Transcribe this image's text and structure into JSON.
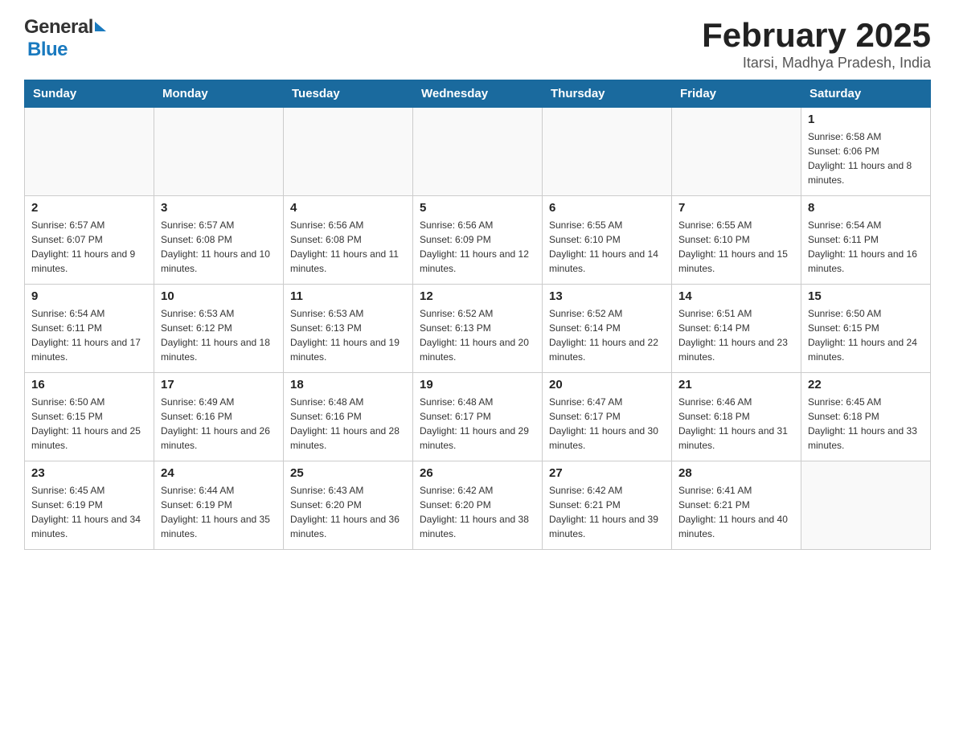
{
  "header": {
    "logo_general": "General",
    "logo_blue": "Blue",
    "title": "February 2025",
    "subtitle": "Itarsi, Madhya Pradesh, India"
  },
  "calendar": {
    "days_of_week": [
      "Sunday",
      "Monday",
      "Tuesday",
      "Wednesday",
      "Thursday",
      "Friday",
      "Saturday"
    ],
    "weeks": [
      [
        {
          "day": "",
          "info": ""
        },
        {
          "day": "",
          "info": ""
        },
        {
          "day": "",
          "info": ""
        },
        {
          "day": "",
          "info": ""
        },
        {
          "day": "",
          "info": ""
        },
        {
          "day": "",
          "info": ""
        },
        {
          "day": "1",
          "info": "Sunrise: 6:58 AM\nSunset: 6:06 PM\nDaylight: 11 hours and 8 minutes."
        }
      ],
      [
        {
          "day": "2",
          "info": "Sunrise: 6:57 AM\nSunset: 6:07 PM\nDaylight: 11 hours and 9 minutes."
        },
        {
          "day": "3",
          "info": "Sunrise: 6:57 AM\nSunset: 6:08 PM\nDaylight: 11 hours and 10 minutes."
        },
        {
          "day": "4",
          "info": "Sunrise: 6:56 AM\nSunset: 6:08 PM\nDaylight: 11 hours and 11 minutes."
        },
        {
          "day": "5",
          "info": "Sunrise: 6:56 AM\nSunset: 6:09 PM\nDaylight: 11 hours and 12 minutes."
        },
        {
          "day": "6",
          "info": "Sunrise: 6:55 AM\nSunset: 6:10 PM\nDaylight: 11 hours and 14 minutes."
        },
        {
          "day": "7",
          "info": "Sunrise: 6:55 AM\nSunset: 6:10 PM\nDaylight: 11 hours and 15 minutes."
        },
        {
          "day": "8",
          "info": "Sunrise: 6:54 AM\nSunset: 6:11 PM\nDaylight: 11 hours and 16 minutes."
        }
      ],
      [
        {
          "day": "9",
          "info": "Sunrise: 6:54 AM\nSunset: 6:11 PM\nDaylight: 11 hours and 17 minutes."
        },
        {
          "day": "10",
          "info": "Sunrise: 6:53 AM\nSunset: 6:12 PM\nDaylight: 11 hours and 18 minutes."
        },
        {
          "day": "11",
          "info": "Sunrise: 6:53 AM\nSunset: 6:13 PM\nDaylight: 11 hours and 19 minutes."
        },
        {
          "day": "12",
          "info": "Sunrise: 6:52 AM\nSunset: 6:13 PM\nDaylight: 11 hours and 20 minutes."
        },
        {
          "day": "13",
          "info": "Sunrise: 6:52 AM\nSunset: 6:14 PM\nDaylight: 11 hours and 22 minutes."
        },
        {
          "day": "14",
          "info": "Sunrise: 6:51 AM\nSunset: 6:14 PM\nDaylight: 11 hours and 23 minutes."
        },
        {
          "day": "15",
          "info": "Sunrise: 6:50 AM\nSunset: 6:15 PM\nDaylight: 11 hours and 24 minutes."
        }
      ],
      [
        {
          "day": "16",
          "info": "Sunrise: 6:50 AM\nSunset: 6:15 PM\nDaylight: 11 hours and 25 minutes."
        },
        {
          "day": "17",
          "info": "Sunrise: 6:49 AM\nSunset: 6:16 PM\nDaylight: 11 hours and 26 minutes."
        },
        {
          "day": "18",
          "info": "Sunrise: 6:48 AM\nSunset: 6:16 PM\nDaylight: 11 hours and 28 minutes."
        },
        {
          "day": "19",
          "info": "Sunrise: 6:48 AM\nSunset: 6:17 PM\nDaylight: 11 hours and 29 minutes."
        },
        {
          "day": "20",
          "info": "Sunrise: 6:47 AM\nSunset: 6:17 PM\nDaylight: 11 hours and 30 minutes."
        },
        {
          "day": "21",
          "info": "Sunrise: 6:46 AM\nSunset: 6:18 PM\nDaylight: 11 hours and 31 minutes."
        },
        {
          "day": "22",
          "info": "Sunrise: 6:45 AM\nSunset: 6:18 PM\nDaylight: 11 hours and 33 minutes."
        }
      ],
      [
        {
          "day": "23",
          "info": "Sunrise: 6:45 AM\nSunset: 6:19 PM\nDaylight: 11 hours and 34 minutes."
        },
        {
          "day": "24",
          "info": "Sunrise: 6:44 AM\nSunset: 6:19 PM\nDaylight: 11 hours and 35 minutes."
        },
        {
          "day": "25",
          "info": "Sunrise: 6:43 AM\nSunset: 6:20 PM\nDaylight: 11 hours and 36 minutes."
        },
        {
          "day": "26",
          "info": "Sunrise: 6:42 AM\nSunset: 6:20 PM\nDaylight: 11 hours and 38 minutes."
        },
        {
          "day": "27",
          "info": "Sunrise: 6:42 AM\nSunset: 6:21 PM\nDaylight: 11 hours and 39 minutes."
        },
        {
          "day": "28",
          "info": "Sunrise: 6:41 AM\nSunset: 6:21 PM\nDaylight: 11 hours and 40 minutes."
        },
        {
          "day": "",
          "info": ""
        }
      ]
    ]
  }
}
